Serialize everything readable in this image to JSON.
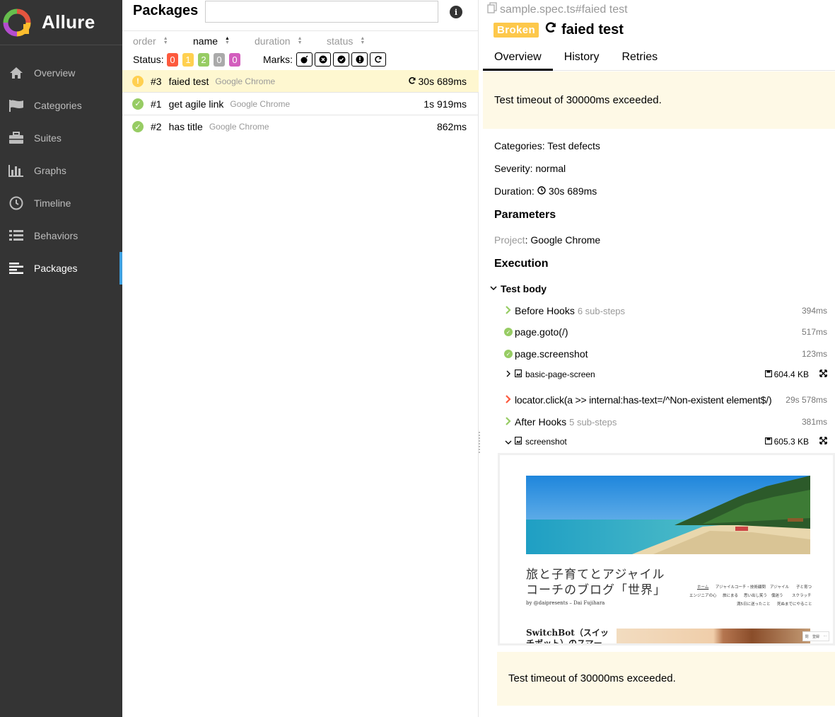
{
  "app": {
    "brand": "Allure",
    "colors": {
      "sidebar_bg": "#343434",
      "accent": "#3ea0e0",
      "failed": "#fd5a3e",
      "broken": "#ffd050",
      "passed": "#97cc64",
      "skipped": "#aaaaaa",
      "unknown": "#d35ebe"
    }
  },
  "sidebar": {
    "items": [
      {
        "label": "Overview",
        "icon": "home-icon"
      },
      {
        "label": "Categories",
        "icon": "flag-icon"
      },
      {
        "label": "Suites",
        "icon": "briefcase-icon"
      },
      {
        "label": "Graphs",
        "icon": "bar-chart-icon"
      },
      {
        "label": "Timeline",
        "icon": "clock-icon"
      },
      {
        "label": "Behaviors",
        "icon": "list-icon"
      },
      {
        "label": "Packages",
        "icon": "align-left-icon",
        "active": true
      }
    ]
  },
  "packages": {
    "title": "Packages",
    "search_placeholder": "",
    "sorters": [
      {
        "label": "order",
        "active": false
      },
      {
        "label": "name",
        "active": true
      },
      {
        "label": "duration",
        "active": false
      },
      {
        "label": "status",
        "active": false
      }
    ],
    "status_label": "Status:",
    "status_counts": [
      {
        "value": "0",
        "status": "failed",
        "color": "#fd5a3e"
      },
      {
        "value": "1",
        "status": "broken",
        "color": "#ffd050"
      },
      {
        "value": "2",
        "status": "passed",
        "color": "#97cc64"
      },
      {
        "value": "0",
        "status": "skipped",
        "color": "#aaaaaa"
      },
      {
        "value": "0",
        "status": "unknown",
        "color": "#d35ebe"
      }
    ],
    "marks_label": "Marks:",
    "marks": [
      "bomb-icon",
      "times-circle-icon",
      "check-circle-icon",
      "exclamation-circle-icon",
      "refresh-icon"
    ],
    "rows": [
      {
        "order": "#3",
        "name": "faied test",
        "param": "Google Chrome",
        "duration": "30s 689ms",
        "status": "broken",
        "retried": true,
        "selected": true
      },
      {
        "order": "#1",
        "name": "get agile link",
        "param": "Google Chrome",
        "duration": "1s 919ms",
        "status": "passed",
        "retried": false,
        "selected": false
      },
      {
        "order": "#2",
        "name": "has title",
        "param": "Google Chrome",
        "duration": "862ms",
        "status": "passed",
        "retried": false,
        "selected": false
      }
    ]
  },
  "detail": {
    "breadcrumb": "sample.spec.ts#faied test",
    "status_badge": "Broken",
    "title": "faied test",
    "tabs": [
      {
        "label": "Overview",
        "active": true
      },
      {
        "label": "History",
        "active": false
      },
      {
        "label": "Retries",
        "active": false
      }
    ],
    "message": "Test timeout of 30000ms exceeded.",
    "categories": "Categories: Test defects",
    "severity": "Severity: normal",
    "duration_label": "Duration:",
    "duration_value": "30s 689ms",
    "parameters_title": "Parameters",
    "param_key": "Project",
    "param_value": ": Google Chrome",
    "execution_title": "Execution",
    "test_body_label": "Test body",
    "steps": [
      {
        "label": "Before Hooks",
        "sub": "6 sub-steps",
        "duration": "394ms",
        "kind": "group"
      },
      {
        "label": "page.goto(/)",
        "sub": "",
        "duration": "517ms",
        "kind": "passed"
      },
      {
        "label": "page.screenshot",
        "sub": "",
        "duration": "123ms",
        "kind": "passed"
      },
      {
        "label": "basic-page-screen",
        "size": "604.4 KB",
        "kind": "attachment"
      },
      {
        "label": "locator.click(a >> internal:has-text=/^Non-existent element$/)",
        "sub": "",
        "duration": "29s 578ms",
        "kind": "failed"
      },
      {
        "label": "After Hooks",
        "sub": "5 sub-steps",
        "duration": "381ms",
        "kind": "group"
      },
      {
        "label": "screenshot",
        "size": "605.3 KB",
        "kind": "attachment-open"
      }
    ],
    "preview": {
      "blog_title_line1": "旅と子育てとアジャイル",
      "blog_title_line2": "コーチのブログ「世界」",
      "blog_by": "by @daipresents – Dai Fujihara",
      "menu_row1": [
        "ホーム",
        "アジャイルコーチ・技術顧問",
        "アジャイル",
        "子と育つ"
      ],
      "menu_row2": [
        "エンジニアの心",
        "旅にまる",
        "思い出し笑う",
        "僕迷う",
        "スクラッチ"
      ],
      "menu_row3": [
        "満5日に送ったこと",
        "死ぬまでにやること"
      ],
      "post_title_line1": "SwitchBot（スイッ",
      "post_title_line2": "チボット）のスマー",
      "corner_labels": [
        "閉",
        "登録",
        "···"
      ]
    },
    "message_bottom": "Test timeout of 30000ms exceeded."
  }
}
